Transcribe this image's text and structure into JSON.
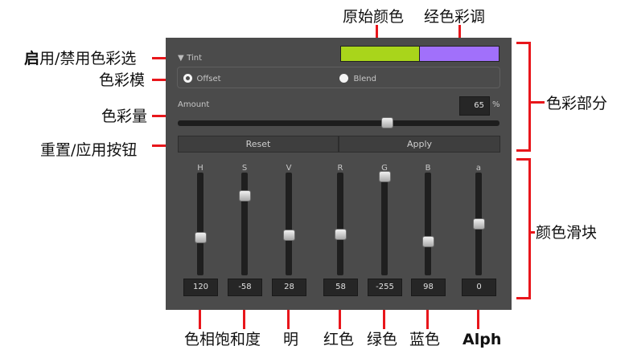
{
  "annotations": {
    "original_color": "原始颜色",
    "tint_color": "经色彩调",
    "enable_tint_bold": "启",
    "enable_tint_rest": "用/禁用色彩选",
    "tint_mode": "色彩模",
    "tint_amount": "色彩量",
    "reset_apply": "重置/应用按钮",
    "tint_section": "色彩部分",
    "color_sliders": "颜色滑块",
    "hue_saturation": "色相饱和度",
    "value": "明",
    "red": "红色",
    "green": "绿色",
    "blue": "蓝色",
    "alpha": "Alph"
  },
  "panel": {
    "tint_toggle_arrow": "▼",
    "tint_label": "Tint",
    "original_swatch_color": "#a9d51b",
    "tinted_swatch_color": "#a170fb",
    "mode": {
      "offset_label": "Offset",
      "blend_label": "Blend",
      "selected": "Offset"
    },
    "amount_label": "Amount",
    "amount_value": "65",
    "amount_unit": "%",
    "amount_fraction": 0.65,
    "reset_label": "Reset",
    "apply_label": "Apply",
    "sliders": [
      {
        "label": "H",
        "value": "120",
        "level": 0.37
      },
      {
        "label": "S",
        "value": "-58",
        "level": 0.77
      },
      {
        "label": "V",
        "value": "28",
        "level": 0.39
      },
      {
        "label": "R",
        "value": "58",
        "level": 0.4
      },
      {
        "label": "G",
        "value": "-255",
        "level": 0.96
      },
      {
        "label": "B",
        "value": "98",
        "level": 0.33
      },
      {
        "label": "a",
        "value": "0",
        "level": 0.5
      }
    ]
  }
}
